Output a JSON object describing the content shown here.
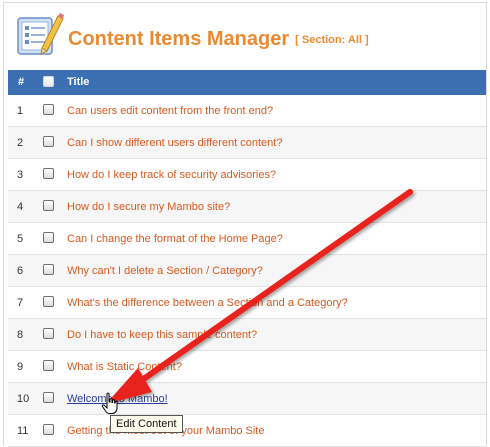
{
  "header": {
    "title": "Content Items Manager",
    "section_filter": "[ Section: All ]",
    "icon": "content-manager-icon"
  },
  "table": {
    "columns": {
      "number": "#",
      "title": "Title"
    },
    "rows": [
      {
        "number": "1",
        "title": "Can users edit content from the front end?"
      },
      {
        "number": "2",
        "title": "Can I show different users different content?"
      },
      {
        "number": "3",
        "title": "How do I keep track of security advisories?"
      },
      {
        "number": "4",
        "title": "How do I secure my Mambo site?"
      },
      {
        "number": "5",
        "title": "Can I change the format of the Home Page?"
      },
      {
        "number": "6",
        "title": "Why can't I delete a Section / Category?"
      },
      {
        "number": "7",
        "title": "What's the difference between a Section and a Category?"
      },
      {
        "number": "8",
        "title": "Do I have to keep this sample content?"
      },
      {
        "number": "9",
        "title": "What is Static Content?"
      },
      {
        "number": "10",
        "title": "Welcome to Mambo!"
      },
      {
        "number": "11",
        "title": "Getting the most out of your Mambo Site"
      }
    ]
  },
  "tooltip": {
    "text": "Edit Content"
  },
  "colors": {
    "accent_orange": "#ea8a32",
    "header_blue": "#3b6fb2",
    "link_orange": "#d85a20",
    "link_hover": "#2a3f9a",
    "annotation_arrow": "#e8201c"
  }
}
